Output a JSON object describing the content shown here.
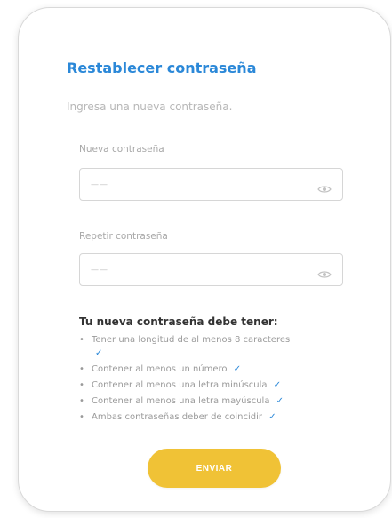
{
  "form": {
    "title": "Restablecer contraseña",
    "subtitle": "Ingresa una nueva contraseña.",
    "fields": [
      {
        "label": "Nueva contraseña",
        "value": "——"
      },
      {
        "label": "Repetir contraseña",
        "value": "——"
      }
    ],
    "requirements_title": "Tu nueva contraseña debe tener:",
    "requirements": [
      "Tener una longitud de al menos 8 caracteres",
      "Contener al menos un número",
      "Contener al menos una letra minúscula",
      "Contener al menos una letra mayúscula",
      "Ambas contraseñas deber de coincidir"
    ],
    "check_symbol": "✓",
    "submit_label": "ENVIAR"
  },
  "colors": {
    "accent": "#2b88d8",
    "button": "#f0c236",
    "card_border": "#d9d9d9",
    "muted_text": "#a8a8a8"
  },
  "icons": {
    "field_icon": "eye-icon",
    "requirement_check": "checkmark-icon"
  }
}
